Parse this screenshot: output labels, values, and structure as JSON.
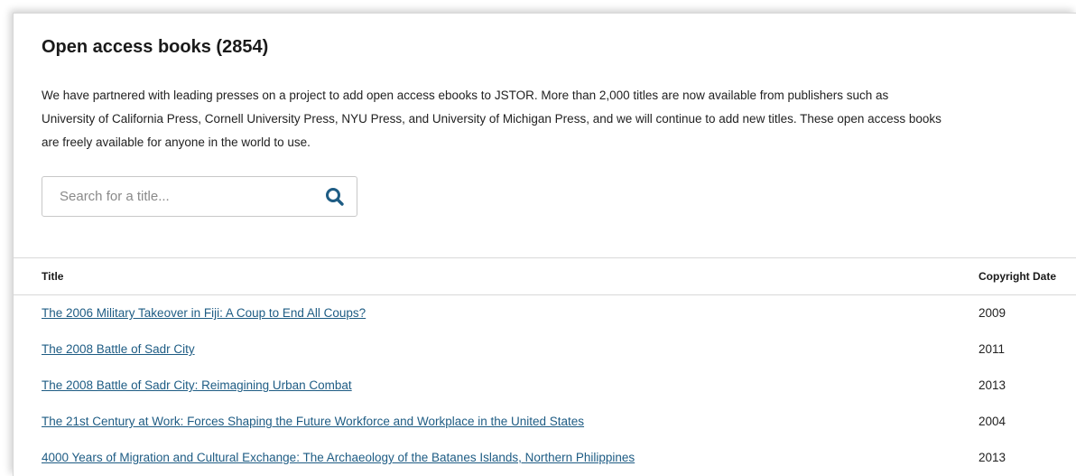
{
  "page": {
    "title": "Open access books (2854)",
    "intro": "We have partnered with leading presses on a project to add open access ebooks to JSTOR. More than 2,000 titles are now available from publishers such as University of California Press, Cornell University Press, NYU Press, and University of Michigan Press, and we will continue to add new titles. These open access books are freely available for anyone in the world to use."
  },
  "search": {
    "placeholder": "Search for a title...",
    "value": "",
    "icon": "search-icon"
  },
  "table": {
    "columns": [
      "Title",
      "Copyright Date"
    ],
    "rows": [
      {
        "title": "The 2006 Military Takeover in Fiji: A Coup to End All Coups?",
        "year": "2009"
      },
      {
        "title": "The 2008 Battle of Sadr City",
        "year": "2011"
      },
      {
        "title": "The 2008 Battle of Sadr City: Reimagining Urban Combat",
        "year": "2013"
      },
      {
        "title": "The 21st Century at Work: Forces Shaping the Future Workforce and Workplace in the United States",
        "year": "2004"
      },
      {
        "title": "4000 Years of Migration and Cultural Exchange: The Archaeology of the Batanes Islands, Northern Philippines",
        "year": "2013"
      }
    ]
  },
  "colors": {
    "link": "#1e5c84",
    "search_icon": "#1e5c84",
    "border": "#d9d9d9"
  }
}
